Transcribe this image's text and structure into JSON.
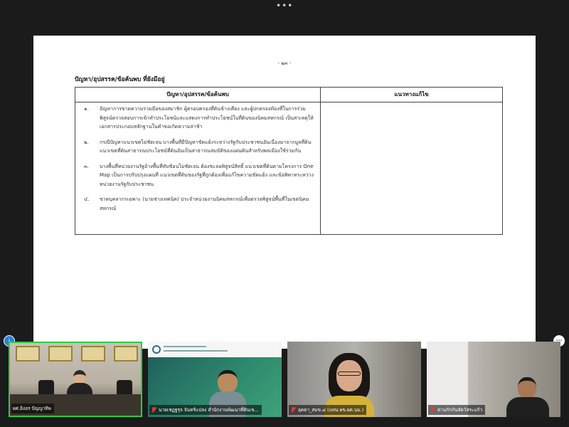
{
  "toolbar": {
    "more_icon": "more-dots-icon"
  },
  "document": {
    "page_number": "- ๒๓ -",
    "heading": "ปัญหา/อุปสรรค/ข้อค้นพบ ที่ยังมีอยู่",
    "table": {
      "headers": [
        "ปัญหา/อุปสรรค/ข้อค้นพบ",
        "แนวทางแก้ไข"
      ],
      "rows": [
        {
          "num": "๑.",
          "text": "ปัญหาการขาดความร่วมมือของสมาชิก ผู้ครอบครองที่ดินข้างเคียง และผู้ปกครองท้องที่ในการร่วมพิสูจน์ตรวจสอบการเข้าทำประโยชน์และแสดงการทำประโยชน์ในที่ดินของนิคมสหกรณ์ เป็นสาเหตุให้เอกสารประกอบหลักฐานในคำขอเกิดความล่าช้า"
        },
        {
          "num": "๒.",
          "text": "กรณีปัญหาแนวเขตไม่ชัดเจน บางพื้นที่มีปัญหาขัดแย้งระหว่างรัฐกับประชาชนอันเนื่องมาจากมูลที่ดิน แนวเขตที่ดินสาธารณประโยชน์ที่ดินอันเป็นสาธารณสมบัติของแผ่นดินสำหรับพลเมืองใช้ร่วมกัน"
        },
        {
          "num": "๓.",
          "text": "บางพื้นที่หน่วยงานรัฐอ้างพื้นที่ทับซ้อนไม่ชัดเจน ต้องชะลอพิสูจน์สิทธิ์ แนวเขตที่ดินตามโครงการ One Map เป็นการปรับปรุงแผนที่ แนวเขตที่ดินของรัฐที่ถูกต้องเพื่อแก้ไขความขัดแย้ง และข้อพิพาทระหว่างหน่วยงานรัฐกับประชาชน"
        },
        {
          "num": "๔.",
          "text": "ขาดบุคลากรเฉพาะ (นายช่างเทคนิค) ประจำหน่วยงานนิคมสหกรณ์เพื่อตรวจพิสูจน์พื้นที่ในเขตนิคมสหกรณ์"
        }
      ]
    }
  },
  "participants": [
    {
      "label": "ผศ.อิงอร ปัญญาทิพ",
      "muted": false,
      "active": true
    },
    {
      "label": "นายเชฏฐรุจ จันทร์แปลง สำนักงานพัฒนาที่ดินเข...",
      "muted": true,
      "active": false
    },
    {
      "label": "อุดดา_สมข.๔ (แทน ผข.ผต.นม.)",
      "muted": true,
      "active": false
    },
    {
      "label": "ด่านกักกันสัตว์สระแก้ว",
      "muted": true,
      "active": false
    }
  ],
  "badges": {
    "left_icon": "person-info-icon",
    "right_icon": "more-dots-icon"
  }
}
